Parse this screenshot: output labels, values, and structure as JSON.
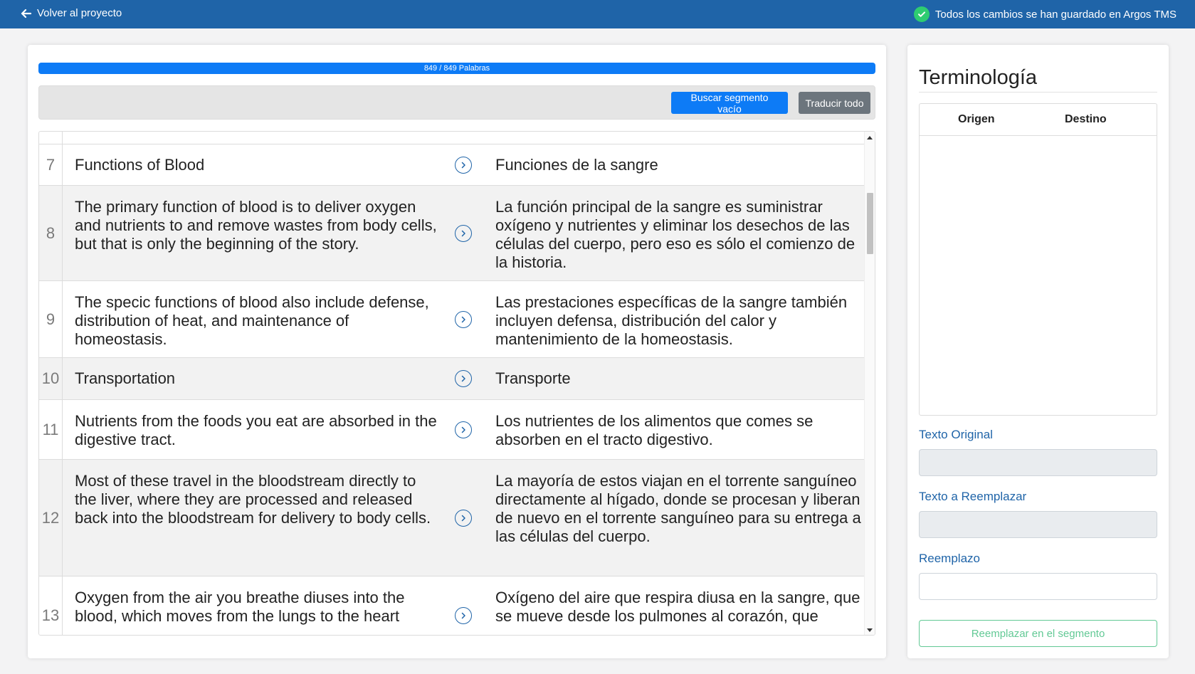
{
  "topbar": {
    "back_label": "Volver al proyecto",
    "save_status": "Todos los cambios se han guardado en Argos TMS"
  },
  "progress": {
    "label": "849 / 849 Palabras",
    "fraction": 1.0
  },
  "toolbar": {
    "find_empty_label": "Buscar segmento vacío",
    "translate_all_label": "Traducir todo"
  },
  "segments": [
    {
      "num": "7",
      "source": "Functions of Blood",
      "target": "Funciones de la sangre"
    },
    {
      "num": "8",
      "source": "The primary function of blood is to deliver oxygen and nutrients to and remove wastes from body cells, but that is only the beginning of the story.",
      "target": "La función principal de la sangre es suministrar oxígeno y nutrientes y eliminar los desechos de las células del cuerpo, pero eso es sólo el comienzo de la historia."
    },
    {
      "num": "9",
      "source": "The specic functions of blood also include defense, distribution of heat, and maintenance of homeostasis.",
      "target": "Las prestaciones específicas de la sangre también incluyen defensa, distribución del calor y mantenimiento de la homeostasis."
    },
    {
      "num": "10",
      "source": "Transportation",
      "target": "Transporte"
    },
    {
      "num": "11",
      "source": "Nutrients from the foods you eat are absorbed in the digestive tract.",
      "target": "Los nutrientes de los alimentos que comes se absorben en el tracto digestivo."
    },
    {
      "num": "12",
      "source": "Most of these travel in the bloodstream directly to the liver, where they are processed and released back into the bloodstream for delivery to body cells.",
      "target": "La mayoría de estos viajan en el torrente sanguíneo directamente al hígado, donde se procesan y liberan de nuevo en el torrente sanguíneo para su entrega a las células del cuerpo."
    },
    {
      "num": "13",
      "source": "Oxygen from the air you breathe diuses into the blood, which moves from the lungs to the heart",
      "target": "Oxígeno del aire que respira diusa en la sangre, que se mueve desde los pulmones al corazón, que"
    }
  ],
  "sidebar": {
    "title": "Terminología",
    "col_source": "Origen",
    "col_target": "Destino",
    "original_text_label": "Texto Original",
    "replace_text_label": "Texto a Reemplazar",
    "replacement_label": "Reemplazo",
    "replace_button_label": "Reemplazar en el segmento"
  }
}
